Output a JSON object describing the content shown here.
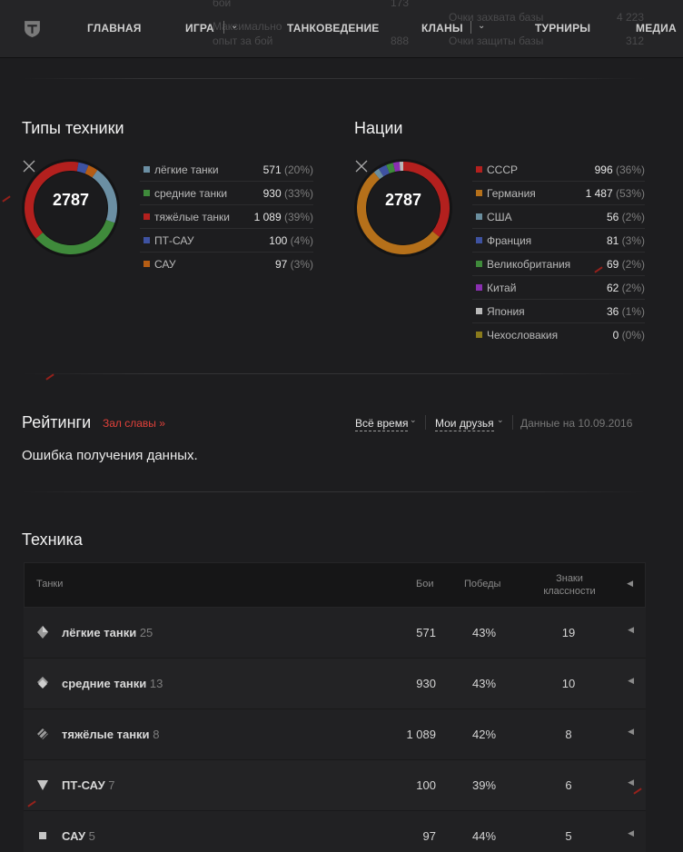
{
  "nav": {
    "items": [
      "ГЛАВНАЯ",
      "ИГРА",
      "ТАНКОВЕДЕНИЕ",
      "КЛАНЫ",
      "ТУРНИРЫ",
      "МЕДИА"
    ],
    "ghost": [
      "бой",
      "173",
      "Очки захвата базы",
      "4 223",
      "Максимально",
      "опыт за бой",
      "888",
      "Очки защиты базы",
      "312"
    ]
  },
  "types": {
    "title": "Типы техники",
    "total": "2787",
    "items": [
      {
        "name": "лёгкие танки",
        "value": "571",
        "pct": "(20%)",
        "color": "#6b8fa3"
      },
      {
        "name": "средние танки",
        "value": "930",
        "pct": "(33%)",
        "color": "#3f8a3b"
      },
      {
        "name": "тяжёлые танки",
        "value": "1 089",
        "pct": "(39%)",
        "color": "#b3201e"
      },
      {
        "name": "ПТ-САУ",
        "value": "100",
        "pct": "(4%)",
        "color": "#3e52a1"
      },
      {
        "name": "САУ",
        "value": "97",
        "pct": "(3%)",
        "color": "#b55d14"
      }
    ]
  },
  "nations": {
    "title": "Нации",
    "total": "2787",
    "items": [
      {
        "name": "СССР",
        "value": "996",
        "pct": "(36%)",
        "color": "#b3201e"
      },
      {
        "name": "Германия",
        "value": "1 487",
        "pct": "(53%)",
        "color": "#b5701a"
      },
      {
        "name": "США",
        "value": "56",
        "pct": "(2%)",
        "color": "#6a8e9e"
      },
      {
        "name": "Франция",
        "value": "81",
        "pct": "(3%)",
        "color": "#3e52a1"
      },
      {
        "name": "Великобритания",
        "value": "69",
        "pct": "(2%)",
        "color": "#3f8a3b"
      },
      {
        "name": "Китай",
        "value": "62",
        "pct": "(2%)",
        "color": "#8a2fb0"
      },
      {
        "name": "Япония",
        "value": "36",
        "pct": "(1%)",
        "color": "#b9b9b9"
      },
      {
        "name": "Чехословакия",
        "value": "0",
        "pct": "(0%)",
        "color": "#8a7a1c"
      }
    ]
  },
  "ratings": {
    "title": "Рейтинги",
    "hall_link": "Зал славы »",
    "filter_time": "Всё время",
    "filter_friends": "Мои друзья",
    "date_note": "Данные на 10.09.2016",
    "error": "Ошибка получения данных."
  },
  "vehicles": {
    "title": "Техника",
    "columns": {
      "tanks": "Танки",
      "battles": "Бои",
      "wins": "Победы",
      "marks": "Знаки классности"
    },
    "rows": [
      {
        "name": "лёгкие танки",
        "count": "25",
        "battles": "571",
        "wins": "43%",
        "marks": "19",
        "icon": "light-tank-icon"
      },
      {
        "name": "средние танки",
        "count": "13",
        "battles": "930",
        "wins": "43%",
        "marks": "10",
        "icon": "medium-tank-icon"
      },
      {
        "name": "тяжёлые танки",
        "count": "8",
        "battles": "1 089",
        "wins": "42%",
        "marks": "8",
        "icon": "heavy-tank-icon"
      },
      {
        "name": "ПТ-САУ",
        "count": "7",
        "battles": "100",
        "wins": "39%",
        "marks": "6",
        "icon": "td-icon"
      },
      {
        "name": "САУ",
        "count": "5",
        "battles": "97",
        "wins": "44%",
        "marks": "5",
        "icon": "spg-icon"
      }
    ]
  }
}
